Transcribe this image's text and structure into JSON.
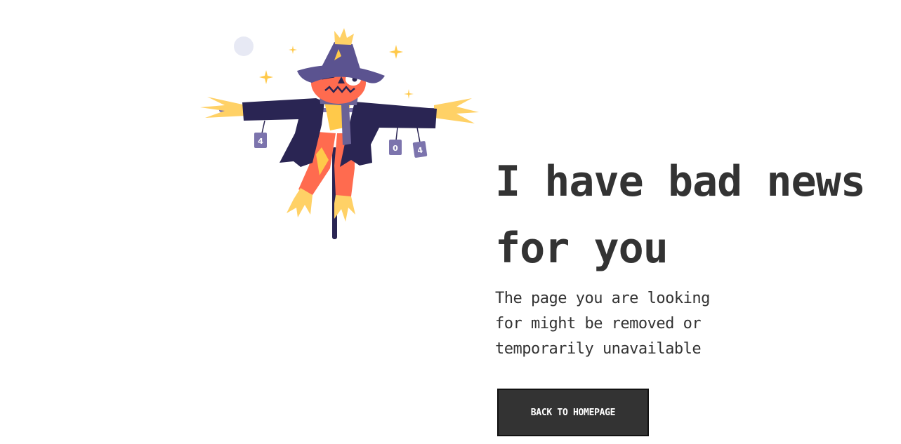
{
  "illustration": {
    "can_labels": [
      "4",
      "0",
      "4"
    ],
    "colors": {
      "hat": "#5b5390",
      "coat": "#2a2553",
      "face": "#ff6b4f",
      "straw": "#ffd166",
      "scarf": "#6a6296",
      "moon": "#e7e9f4"
    }
  },
  "headline": "I have bad news for you",
  "message": "The page you are looking for might be removed or temporarily unavailable",
  "button": {
    "label": "BACK TO HOMEPAGE"
  }
}
